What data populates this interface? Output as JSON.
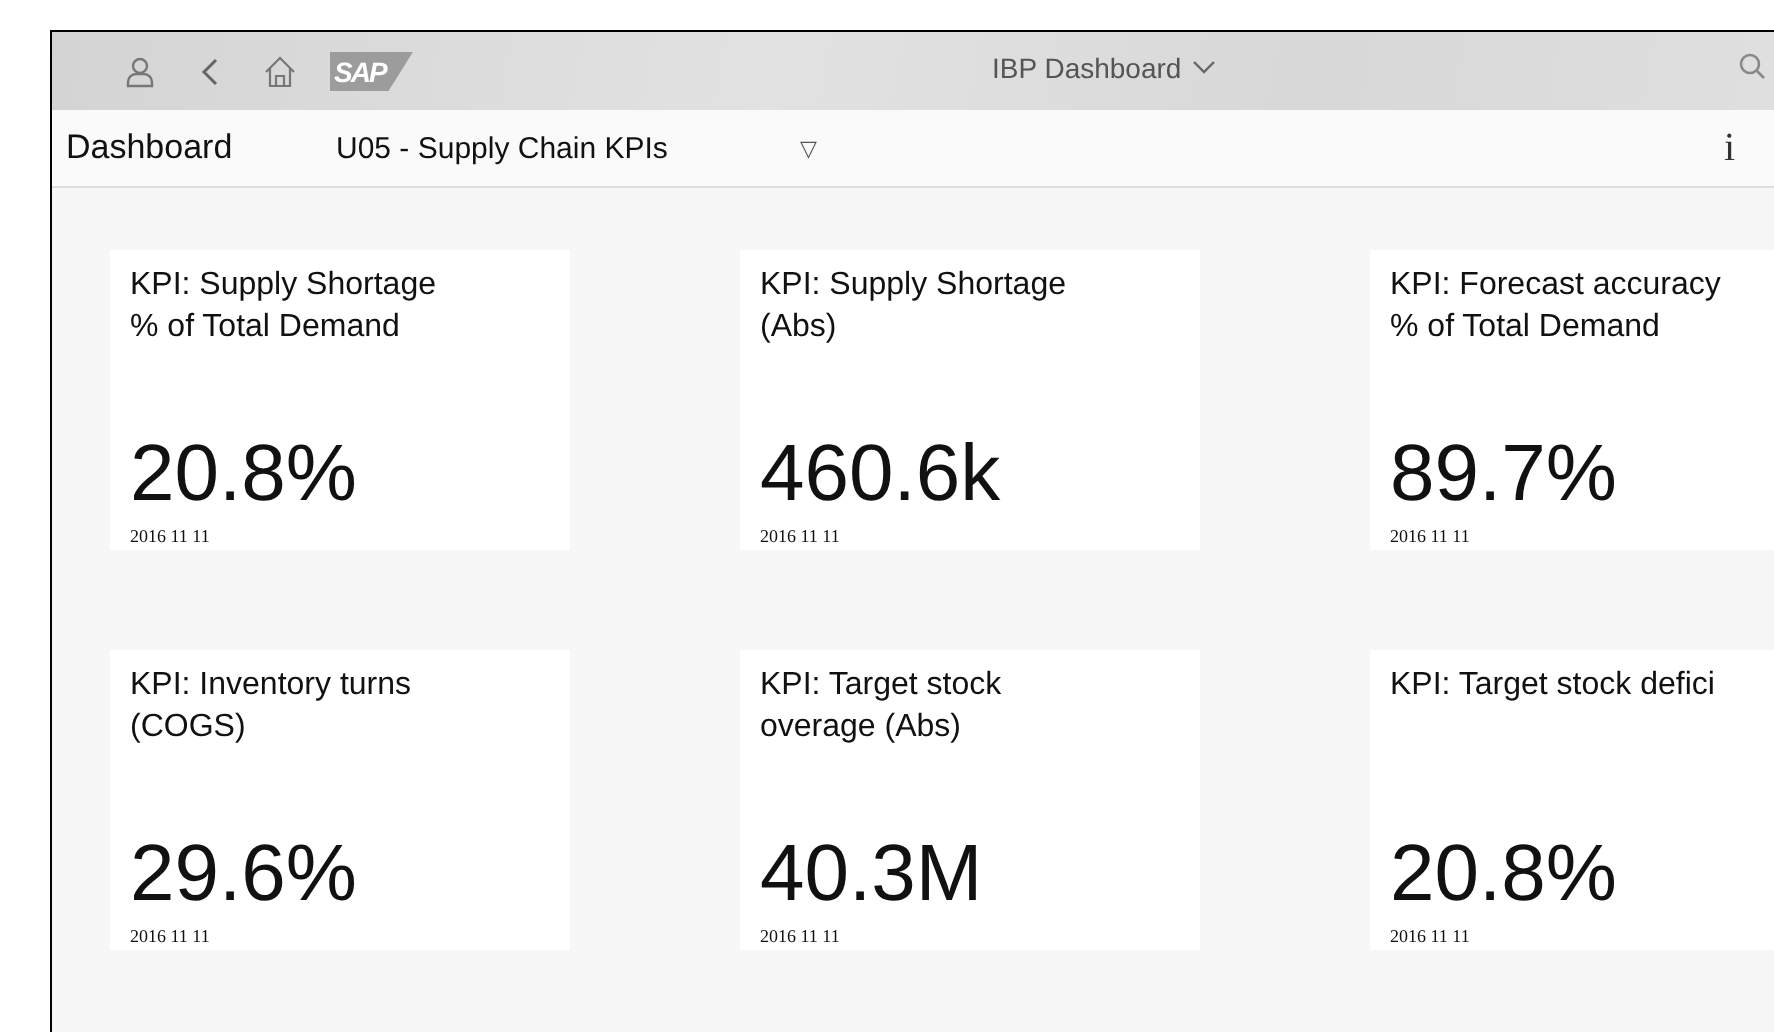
{
  "shell": {
    "logo": "SAP",
    "title": "IBP Dashboard"
  },
  "subheader": {
    "label": "Dashboard",
    "selector": "U05 - Supply Chain KPIs",
    "selector_caret": "▽",
    "info": "i"
  },
  "tiles": [
    {
      "title": "KPI: Supply Shortage\n% of Total Demand",
      "value": "20.8%",
      "date": "2016 11 11"
    },
    {
      "title": "KPI: Supply Shortage\n(Abs)",
      "value": "460.6k",
      "date": "2016 11 11"
    },
    {
      "title": "KPI: Forecast accuracy\n% of Total Demand",
      "value": "89.7%",
      "date": "2016 11 11"
    },
    {
      "title": "KPI: Inventory turns\n(COGS)",
      "value": "29.6%",
      "date": "2016 11 11"
    },
    {
      "title": "KPI: Target stock\noverage (Abs)",
      "value": "40.3M",
      "date": "2016 11 11"
    },
    {
      "title": "KPI: Target stock defici",
      "value": "20.8%",
      "date": "2016 11 11"
    }
  ]
}
